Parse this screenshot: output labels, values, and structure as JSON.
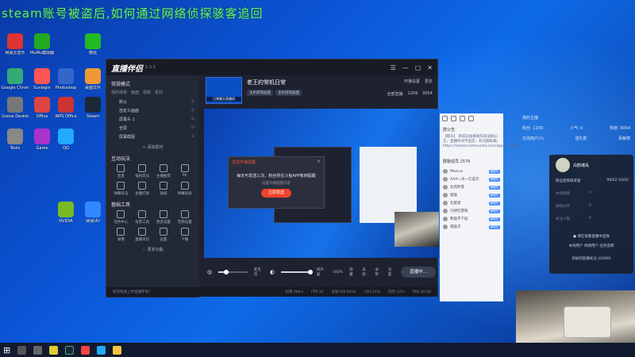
{
  "banner": "steam账号被盗后,如何通过网络侦探骇客追回",
  "desktop_icons": [
    {
      "label": "网易云音乐",
      "color": "#d33"
    },
    {
      "label": "MuMu模拟器",
      "color": "#2a2"
    },
    {
      "label": "Google Chrome",
      "color": "#3a7"
    },
    {
      "label": "Sunlogin",
      "color": "#f55"
    },
    {
      "label": "Goose Desktop",
      "color": "#777"
    },
    {
      "label": "Office",
      "color": "#d44"
    },
    {
      "label": "Photoshop",
      "color": "#36c"
    },
    {
      "label": "桌面文件",
      "color": "#e93"
    },
    {
      "label": "Tools",
      "color": "#888"
    },
    {
      "label": "Game",
      "color": "#a3c"
    },
    {
      "label": "WPS Office",
      "color": "#c33"
    },
    {
      "label": "微信",
      "color": "#2b2"
    },
    {
      "label": "Steam",
      "color": "#1b2838"
    },
    {
      "label": "QQ",
      "color": "#2af"
    },
    {
      "label": "NVIDIA",
      "color": "#7b2"
    },
    {
      "label": "网易UU",
      "color": "#38f"
    }
  ],
  "app": {
    "title": "直播伴侣",
    "version": "5.3.3",
    "window_controls": [
      "☰",
      "—",
      "▢",
      "✕"
    ],
    "left": {
      "section_scene": "常规模式",
      "scene_tabs": [
        "我的场景",
        "画面",
        "视频",
        "素材"
      ],
      "scenes": [
        {
          "label": "默认",
          "right": "⊙"
        },
        {
          "label": "自定义画面",
          "right": "⊙"
        },
        {
          "label": "屏幕头 1",
          "right": "⊙"
        },
        {
          "label": "全屏",
          "right": "⊙"
        },
        {
          "label": "屏幕截图",
          "right": "⊙"
        }
      ],
      "add_material": "+ 添加素材",
      "section_interact": "互动玩法",
      "interact_tools": [
        "连麦",
        "福利玩法",
        "主播推荐",
        "PK",
        "弹幕玩法",
        "主播打榜",
        "贴纸",
        "弹幕投屏"
      ],
      "section_basic": "基础工具",
      "basic_tools": [
        "任务中心",
        "背景工具",
        "更多设置",
        "音频设置",
        "录像",
        "直播日历",
        "设置",
        "下播"
      ],
      "more": "··· 更多功能"
    },
    "room": {
      "title": "老王的常机日常",
      "thumb_tag": "日常聊天直播间",
      "tags": [
        "主机游戏画面",
        "主机游戏画面"
      ],
      "stats_top": [
        "开播设置",
        "更多"
      ],
      "stats_bottom": [
        "全部直播",
        "1209",
        "9054"
      ]
    },
    "preview": {
      "dialog_title": "发送开播提醒",
      "dialog_text": "每天可发送三次，粉丝将在斗鱼APP收到提醒",
      "dialog_link": "设置开播提醒内容",
      "dialog_button": "立即发送"
    },
    "controls": {
      "mic_label": "麦克风",
      "speaker_label": "扬声器",
      "volume": "100%",
      "items": [
        "隐藏",
        "美颜",
        "录制",
        "设置"
      ],
      "start_button": "直播中..."
    },
    "status_bar": [
      "如何快速上手直播伴侣?",
      "码率 0kb/s",
      "FPS 30",
      "丢帧 0(0.00%)",
      "CPU 11%",
      "内存 22%",
      "时长 00:00"
    ]
  },
  "chat": {
    "notice_header": "群公告",
    "notice_text": "【聊天】 新成员加群请先阅读群公告，直播时间不固定，有问题私聊。https://steamcommunity.com/app/1213550",
    "members_header": "群聊成员 2579",
    "members": [
      {
        "name": "Marcus",
        "badge": "管理员"
      },
      {
        "name": "AAA一天一亿美元",
        "badge": "管理员"
      },
      {
        "name": "北风吹雪",
        "badge": "管理员"
      },
      {
        "name": "星辰",
        "badge": "管理员"
      },
      {
        "name": "北极星",
        "badge": "管理员"
      },
      {
        "name": "只想打游戏",
        "badge": "管理员"
      },
      {
        "name": "熊猫不下班",
        "badge": "管理员"
      },
      {
        "name": "夜猫子",
        "badge": "管理员"
      }
    ]
  },
  "rpanel": {
    "title": "我的主播",
    "fans_label": "粉丝: 1209",
    "popularity": "人气: 0",
    "hot": "热度: 9054",
    "row2": [
      "在线用户(1)",
      "送礼数",
      "贡献榜"
    ],
    "card_name": "白鹤滩岛",
    "card_label": "粉丝团等级荣誉",
    "card_date": "09/02-10/02",
    "lines": [
      "本场观看",
      "进场分享",
      "关注人数"
    ],
    "lines_values": [
      "0",
      "0",
      "0"
    ],
    "footer_link": "● 请在观看直播中选择",
    "footer_tabs": "本场用户  周榜用户  任务说明",
    "footer_btn": "添加到直播关注 (0/200)"
  },
  "taskbar_icons": [
    "windows",
    "search",
    "task-view",
    "chrome",
    "steam",
    "douyin",
    "qq",
    "file-explorer"
  ]
}
